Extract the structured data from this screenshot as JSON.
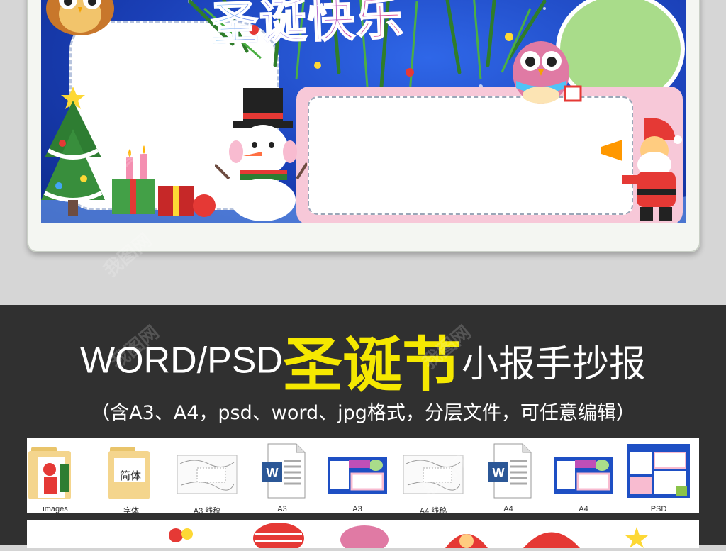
{
  "poster": {
    "title_art": "圣诞快乐"
  },
  "banner": {
    "headline_a": "WORD/PSD",
    "headline_b": "圣诞节",
    "headline_c": "小报手抄报",
    "subline": "（含A3、A4，psd、word、jpg格式，分层文件，可任意编辑）"
  },
  "files": [
    {
      "label": "images",
      "icon": "folder-icon"
    },
    {
      "label": "字体",
      "icon": "folder-icon",
      "folder_text": "简体"
    },
    {
      "label": "A3 线稿",
      "icon": "image-thumbnail-icon"
    },
    {
      "label": "A3",
      "icon": "word-doc-icon"
    },
    {
      "label": "A3",
      "icon": "image-thumbnail-icon"
    },
    {
      "label": "A4 线稿",
      "icon": "image-thumbnail-icon"
    },
    {
      "label": "A4",
      "icon": "word-doc-icon"
    },
    {
      "label": "A4",
      "icon": "image-thumbnail-icon"
    },
    {
      "label": "PSD",
      "icon": "psd-thumbnail-icon"
    }
  ],
  "colors": {
    "banner_bg": "#303030",
    "headline_accent": "#f5e800",
    "poster_bg": "#1a3fb6",
    "word_blue": "#2b5797"
  }
}
